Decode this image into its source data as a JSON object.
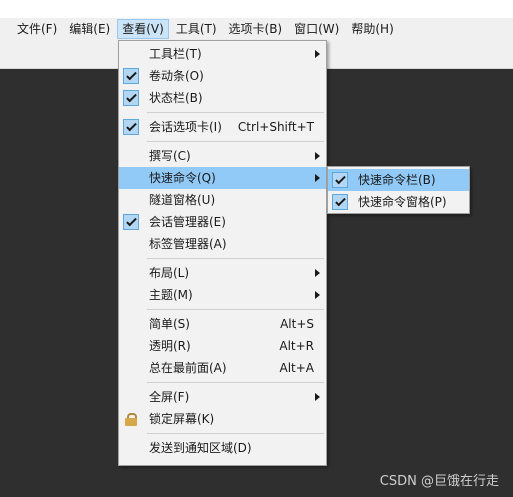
{
  "menubar": {
    "items": [
      "文件(F)",
      "编辑(E)",
      "查看(V)",
      "工具(T)",
      "选项卡(B)",
      "窗口(W)",
      "帮助(H)"
    ],
    "active": "查看(V)"
  },
  "view_menu": {
    "toolbar": "工具栏(T)",
    "scrollbar": "卷动条(O)",
    "statusbar": "状态栏(B)",
    "session_tabs": "会话选项卡(I)",
    "session_tabs_shortcut": "Ctrl+Shift+T",
    "compose": "撰写(C)",
    "quick_commands": "快速命令(Q)",
    "tunnel_pane": "隧道窗格(U)",
    "session_manager": "会话管理器(E)",
    "tag_manager": "标签管理器(A)",
    "layout": "布局(L)",
    "theme": "主题(M)",
    "simple": "简单(S)",
    "simple_shortcut": "Alt+S",
    "transparent": "透明(R)",
    "transparent_shortcut": "Alt+R",
    "always_on_top": "总在最前面(A)",
    "always_on_top_shortcut": "Alt+A",
    "fullscreen": "全屏(F)",
    "lock_screen": "锁定屏幕(K)",
    "send_to_tray": "发送到通知区域(D)"
  },
  "quick_commands_submenu": {
    "quick_command_bar": "快速命令栏(B)",
    "quick_command_pane": "快速命令窗格(P)"
  },
  "watermark": "CSDN @巨饿在行走",
  "colors": {
    "highlight": "#91c9f7",
    "background": "#2f2f2f",
    "menu": "#f2f2f2"
  }
}
